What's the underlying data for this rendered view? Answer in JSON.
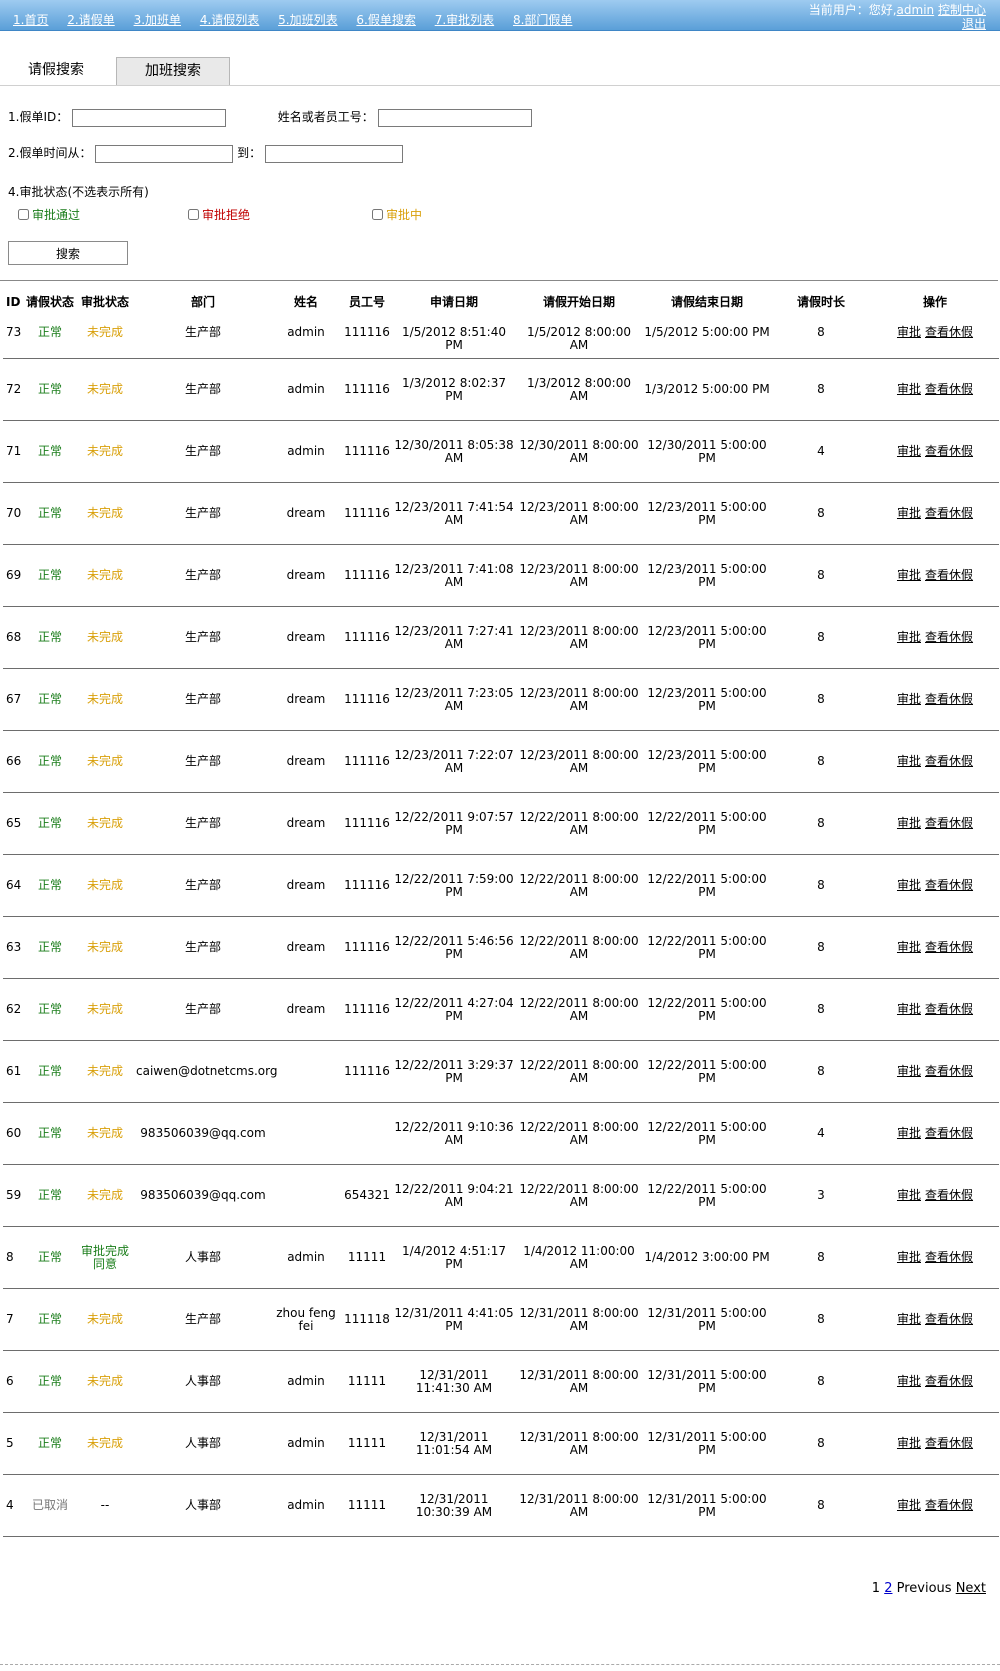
{
  "nav": {
    "items": [
      "1.首页",
      "2.请假单",
      "3.加班单",
      "4.请假列表",
      "5.加班列表",
      "6.假单搜索",
      "7.审批列表",
      "8.部门假单"
    ],
    "user_prefix": "当前用户：您好,",
    "user_name": "admin",
    "control": "控制中心",
    "logout": "退出"
  },
  "tabs": {
    "leave_search": "请假搜索",
    "overtime_search": "加班搜索"
  },
  "form": {
    "leave_id_label": "1.假单ID：",
    "name_label": "姓名或者员工号：",
    "time_from_label": "2.假单时间从：",
    "time_to_label": "到：",
    "status_label": "4.审批状态(不选表示所有)",
    "status_ok": "审批通过",
    "status_reject": "审批拒绝",
    "status_pending": "审批中",
    "search_button": "搜索"
  },
  "table": {
    "headers": [
      "ID",
      "请假状态",
      "审批状态",
      "部门",
      "姓名",
      "员工号",
      "申请日期",
      "请假开始日期",
      "请假结束日期",
      "请假时长",
      "操作"
    ],
    "op_approve": "审批",
    "op_view": "查看休假",
    "rows": [
      {
        "id": "73",
        "status": "正常",
        "approval": "未完成",
        "dept": "生产部",
        "name": "admin",
        "emp": "111116",
        "apply": "1/5/2012 8:51:40 PM",
        "start": "1/5/2012 8:00:00 AM",
        "end": "1/5/2012 5:00:00 PM",
        "hours": "8"
      },
      {
        "id": "72",
        "status": "正常",
        "approval": "未完成",
        "dept": "生产部",
        "name": "admin",
        "emp": "111116",
        "apply": "1/3/2012 8:02:37 PM",
        "start": "1/3/2012 8:00:00 AM",
        "end": "1/3/2012 5:00:00 PM",
        "hours": "8"
      },
      {
        "id": "71",
        "status": "正常",
        "approval": "未完成",
        "dept": "生产部",
        "name": "admin",
        "emp": "111116",
        "apply": "12/30/2011 8:05:38 AM",
        "start": "12/30/2011 8:00:00 AM",
        "end": "12/30/2011 5:00:00 PM",
        "hours": "4"
      },
      {
        "id": "70",
        "status": "正常",
        "approval": "未完成",
        "dept": "生产部",
        "name": "dream",
        "emp": "111116",
        "apply": "12/23/2011 7:41:54 AM",
        "start": "12/23/2011 8:00:00 AM",
        "end": "12/23/2011 5:00:00 PM",
        "hours": "8"
      },
      {
        "id": "69",
        "status": "正常",
        "approval": "未完成",
        "dept": "生产部",
        "name": "dream",
        "emp": "111116",
        "apply": "12/23/2011 7:41:08 AM",
        "start": "12/23/2011 8:00:00 AM",
        "end": "12/23/2011 5:00:00 PM",
        "hours": "8"
      },
      {
        "id": "68",
        "status": "正常",
        "approval": "未完成",
        "dept": "生产部",
        "name": "dream",
        "emp": "111116",
        "apply": "12/23/2011 7:27:41 AM",
        "start": "12/23/2011 8:00:00 AM",
        "end": "12/23/2011 5:00:00 PM",
        "hours": "8"
      },
      {
        "id": "67",
        "status": "正常",
        "approval": "未完成",
        "dept": "生产部",
        "name": "dream",
        "emp": "111116",
        "apply": "12/23/2011 7:23:05 AM",
        "start": "12/23/2011 8:00:00 AM",
        "end": "12/23/2011 5:00:00 PM",
        "hours": "8"
      },
      {
        "id": "66",
        "status": "正常",
        "approval": "未完成",
        "dept": "生产部",
        "name": "dream",
        "emp": "111116",
        "apply": "12/23/2011 7:22:07 AM",
        "start": "12/23/2011 8:00:00 AM",
        "end": "12/23/2011 5:00:00 PM",
        "hours": "8"
      },
      {
        "id": "65",
        "status": "正常",
        "approval": "未完成",
        "dept": "生产部",
        "name": "dream",
        "emp": "111116",
        "apply": "12/22/2011 9:07:57 PM",
        "start": "12/22/2011 8:00:00 AM",
        "end": "12/22/2011 5:00:00 PM",
        "hours": "8"
      },
      {
        "id": "64",
        "status": "正常",
        "approval": "未完成",
        "dept": "生产部",
        "name": "dream",
        "emp": "111116",
        "apply": "12/22/2011 7:59:00 PM",
        "start": "12/22/2011 8:00:00 AM",
        "end": "12/22/2011 5:00:00 PM",
        "hours": "8"
      },
      {
        "id": "63",
        "status": "正常",
        "approval": "未完成",
        "dept": "生产部",
        "name": "dream",
        "emp": "111116",
        "apply": "12/22/2011 5:46:56 PM",
        "start": "12/22/2011 8:00:00 AM",
        "end": "12/22/2011 5:00:00 PM",
        "hours": "8"
      },
      {
        "id": "62",
        "status": "正常",
        "approval": "未完成",
        "dept": "生产部",
        "name": "dream",
        "emp": "111116",
        "apply": "12/22/2011 4:27:04 PM",
        "start": "12/22/2011 8:00:00 AM",
        "end": "12/22/2011 5:00:00 PM",
        "hours": "8"
      },
      {
        "id": "61",
        "status": "正常",
        "approval": "未完成",
        "dept": "caiwen@dotnetcms.org",
        "name": "",
        "emp": "111116",
        "apply": "12/22/2011 3:29:37 PM",
        "start": "12/22/2011 8:00:00 AM",
        "end": "12/22/2011 5:00:00 PM",
        "hours": "8"
      },
      {
        "id": "60",
        "status": "正常",
        "approval": "未完成",
        "dept": "983506039@qq.com",
        "name": "",
        "emp": "",
        "apply": "12/22/2011 9:10:36 AM",
        "start": "12/22/2011 8:00:00 AM",
        "end": "12/22/2011 5:00:00 PM",
        "hours": "4"
      },
      {
        "id": "59",
        "status": "正常",
        "approval": "未完成",
        "dept": "983506039@qq.com",
        "name": "",
        "emp": "654321",
        "apply": "12/22/2011 9:04:21 AM",
        "start": "12/22/2011 8:00:00 AM",
        "end": "12/22/2011 5:00:00 PM",
        "hours": "3"
      },
      {
        "id": "8",
        "status": "正常",
        "approval": "审批完成 同意",
        "dept": "人事部",
        "name": "admin",
        "emp": "11111",
        "apply": "1/4/2012 4:51:17 PM",
        "start": "1/4/2012 11:00:00 AM",
        "end": "1/4/2012 3:00:00 PM",
        "hours": "8"
      },
      {
        "id": "7",
        "status": "正常",
        "approval": "未完成",
        "dept": "生产部",
        "name": "zhou feng fei",
        "emp": "111118",
        "apply": "12/31/2011 4:41:05 PM",
        "start": "12/31/2011 8:00:00 AM",
        "end": "12/31/2011 5:00:00 PM",
        "hours": "8"
      },
      {
        "id": "6",
        "status": "正常",
        "approval": "未完成",
        "dept": "人事部",
        "name": "admin",
        "emp": "11111",
        "apply": "12/31/2011 11:41:30 AM",
        "start": "12/31/2011 8:00:00 AM",
        "end": "12/31/2011 5:00:00 PM",
        "hours": "8"
      },
      {
        "id": "5",
        "status": "正常",
        "approval": "未完成",
        "dept": "人事部",
        "name": "admin",
        "emp": "11111",
        "apply": "12/31/2011 11:01:54 AM",
        "start": "12/31/2011 8:00:00 AM",
        "end": "12/31/2011 5:00:00 PM",
        "hours": "8"
      },
      {
        "id": "4",
        "status": "已取消",
        "approval": "--",
        "dept": "人事部",
        "name": "admin",
        "emp": "11111",
        "apply": "12/31/2011 10:30:39 AM",
        "start": "12/31/2011 8:00:00 AM",
        "end": "12/31/2011 5:00:00 PM",
        "hours": "8"
      }
    ]
  },
  "pager": {
    "current": "1",
    "page2": "2",
    "previous": "Previous",
    "next": "Next"
  }
}
